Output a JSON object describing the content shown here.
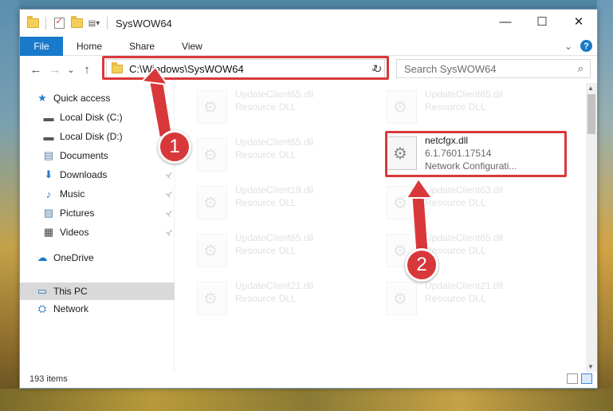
{
  "window": {
    "title": "SysWOW64",
    "minimize": "—",
    "maximize": "☐",
    "close": "✕"
  },
  "ribbon": {
    "tabs": [
      "File",
      "Home",
      "Share",
      "View"
    ],
    "help": "?"
  },
  "navbar": {
    "back": "←",
    "forward": "→",
    "recent": "⌄",
    "up": "↑",
    "address": "C:\\Windows\\SysWOW64",
    "address_dropdown": "⌄",
    "refresh": "↻",
    "search_placeholder": "Search SysWOW64",
    "search_icon": "⚲"
  },
  "nav_pane": {
    "items": [
      {
        "label": "Quick access",
        "icon": "star-icon",
        "glyph": "★",
        "color": "#2a7ad0",
        "pinned": false
      },
      {
        "label": "Local Disk (C:)",
        "icon": "drive-icon",
        "glyph": "▬",
        "color": "#555555",
        "pinned": false
      },
      {
        "label": "Local Disk (D:)",
        "icon": "drive-icon",
        "glyph": "▬",
        "color": "#555555",
        "pinned": false
      },
      {
        "label": "Documents",
        "icon": "documents-icon",
        "glyph": "▤",
        "color": "#5a7fa8",
        "pinned": true
      },
      {
        "label": "Downloads",
        "icon": "downloads-icon",
        "glyph": "⬇",
        "color": "#2a7ad0",
        "pinned": true
      },
      {
        "label": "Music",
        "icon": "music-icon",
        "glyph": "♪",
        "color": "#2a7ad0",
        "pinned": true
      },
      {
        "label": "Pictures",
        "icon": "pictures-icon",
        "glyph": "▨",
        "color": "#5a8ab0",
        "pinned": true
      },
      {
        "label": "Videos",
        "icon": "videos-icon",
        "glyph": "▦",
        "color": "#444444",
        "pinned": true
      },
      {
        "label": "OneDrive",
        "icon": "onedrive-icon",
        "glyph": "☁",
        "color": "#1979ca",
        "pinned": false
      },
      {
        "label": "This PC",
        "icon": "this-pc-icon",
        "glyph": "▭",
        "color": "#2a7ad0",
        "pinned": false
      },
      {
        "label": "Network",
        "icon": "network-icon",
        "glyph": "⛭",
        "color": "#2a7ad0",
        "pinned": false
      }
    ],
    "pin_glyph": "📌"
  },
  "files": [
    {
      "name": "UpdateClient65.dll",
      "type": "Resource DLL",
      "version": ""
    },
    {
      "name": "UpdateClient65.dll",
      "type": "Resource DLL",
      "version": ""
    },
    {
      "name": "UpdateClient65.dll",
      "type": "Resource DLL",
      "version": ""
    },
    {
      "name": "netcfgx.dll",
      "version": "6.1.7601.17514",
      "type": "Network Configurati..."
    },
    {
      "name": "UpdateClient19.dll",
      "type": "Resource DLL",
      "version": ""
    },
    {
      "name": "UpdateClient63.dll",
      "type": "Resource DLL",
      "version": ""
    },
    {
      "name": "UpdateClient65.dll",
      "type": "Resource DLL",
      "version": ""
    },
    {
      "name": "UpdateClient65.dll",
      "type": "Resource DLL",
      "version": ""
    },
    {
      "name": "UpdateClient21.dll",
      "type": "Resource DLL",
      "version": ""
    },
    {
      "name": "UpdateClient21.dll",
      "type": "Resource DLL",
      "version": ""
    }
  ],
  "status": {
    "item_count": "193 items"
  },
  "callouts": [
    "1",
    "2"
  ],
  "colors": {
    "accent": "#1979ca",
    "highlight": "#d9383a",
    "selected_nav": "#d9d9d9"
  }
}
